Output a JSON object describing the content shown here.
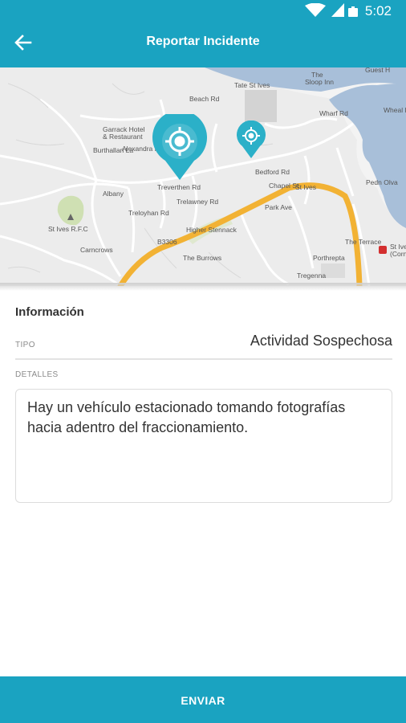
{
  "status": {
    "time": "5:02",
    "icons": [
      "wifi-icon",
      "signal-icon",
      "battery-icon"
    ]
  },
  "appbar": {
    "title": "Reportar Incidente",
    "back_icon": "arrow-back-icon",
    "color": "#1aa3c1"
  },
  "map": {
    "labels": {
      "garrack": "Garrack Hotel",
      "garrack2": "& Restaurant",
      "beach": "Beach Rd",
      "tate": "Tate St Ives",
      "sloop": "The",
      "sloop2": "Sloop Inn",
      "guest": "Guest H",
      "burthallan": "Burthallan La",
      "alexandra": "Alexandra Rd",
      "trevarthen": "Treverthen Rd",
      "treloyhan": "Treloyhan Rd",
      "bedford": "Bedford Rd",
      "chapel": "Chapel St",
      "stives": "St Ives",
      "pedn": "Pedn Olva",
      "park": "Park Ave",
      "rfc": "St Ives R.F.C",
      "b3306": "B3306",
      "higher": "Higher Stennack",
      "theterrace": "The Terrace",
      "trelawney": "Trelawney Rd",
      "carncrows": "Carncrows",
      "stives_station": "St Ive",
      "stives_station2": "(Corn",
      "wharf": "Wharf Rd",
      "tregenna": "Tregenna",
      "porthrepta": "Porthrepta",
      "burrows": "The Burrows",
      "albany": "Albany",
      "wheal": "Wheal Dream"
    }
  },
  "form": {
    "section_title": "Información",
    "tipo_label": "TIPO",
    "tipo_value": "Actividad Sospechosa",
    "detalles_label": "DETALLES",
    "detalles_value": "Hay un vehículo estacionado tomando fotografías hacia adentro del fraccionamiento."
  },
  "bottom": {
    "label": "ENVIAR",
    "color": "#1aa3c1"
  }
}
